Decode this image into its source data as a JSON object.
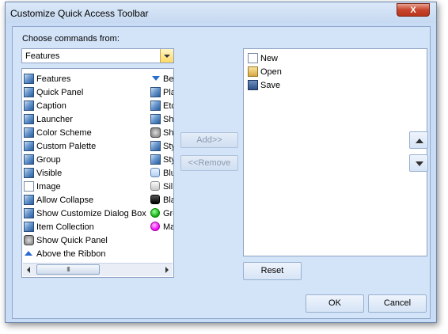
{
  "window": {
    "title": "Customize Quick Access Toolbar",
    "close_label": "X"
  },
  "left": {
    "choose_label": "Choose commands from:",
    "combo_value": "Features",
    "commands_col1": [
      {
        "icon": "picture-icon",
        "label": "Features"
      },
      {
        "icon": "picture-icon",
        "label": "Quick Panel"
      },
      {
        "icon": "picture-icon",
        "label": "Caption"
      },
      {
        "icon": "picture-icon",
        "label": "Launcher"
      },
      {
        "icon": "picture-icon",
        "label": "Color Scheme"
      },
      {
        "icon": "picture-icon",
        "label": "Custom Palette"
      },
      {
        "icon": "picture-icon",
        "label": "Group"
      },
      {
        "icon": "picture-icon",
        "label": "Visible"
      },
      {
        "icon": "document-icon",
        "label": "Image"
      },
      {
        "icon": "picture-icon",
        "label": "Allow Collapse"
      },
      {
        "icon": "picture-icon",
        "label": "Show Customize Dialog Box"
      },
      {
        "icon": "picture-icon",
        "label": "Item Collection"
      },
      {
        "icon": "quick-panel-icon",
        "label": "Show Quick Panel"
      },
      {
        "icon": "triangle-up-icon",
        "label": "Above the Ribbon"
      }
    ],
    "commands_col2": [
      {
        "icon": "triangle-down-icon",
        "label": "Bel"
      },
      {
        "icon": "picture-icon",
        "label": "Pla"
      },
      {
        "icon": "picture-icon",
        "label": "Etc"
      },
      {
        "icon": "picture-icon",
        "label": "Sha"
      },
      {
        "icon": "quick-panel-icon",
        "label": "Sho"
      },
      {
        "icon": "picture-icon",
        "label": "Sty"
      },
      {
        "icon": "picture-icon",
        "label": "Sty"
      },
      {
        "icon": "blue-swatch-icon",
        "label": "Blu"
      },
      {
        "icon": "silver-swatch-icon",
        "label": "Sil"
      },
      {
        "icon": "black-swatch-icon",
        "label": "Bla"
      },
      {
        "icon": "green-swatch-icon",
        "label": "Gre"
      },
      {
        "icon": "magenta-swatch-icon",
        "label": "Ma"
      }
    ],
    "scroll_thumb": "III"
  },
  "middle": {
    "add_label": "Add>>",
    "remove_label": "<<Remove"
  },
  "right": {
    "toolbar_items": [
      {
        "icon": "document-icon",
        "label": "New"
      },
      {
        "icon": "folder-open-icon",
        "label": "Open"
      },
      {
        "icon": "save-icon",
        "label": "Save"
      }
    ],
    "reset_label": "Reset"
  },
  "footer": {
    "ok_label": "OK",
    "cancel_label": "Cancel"
  }
}
